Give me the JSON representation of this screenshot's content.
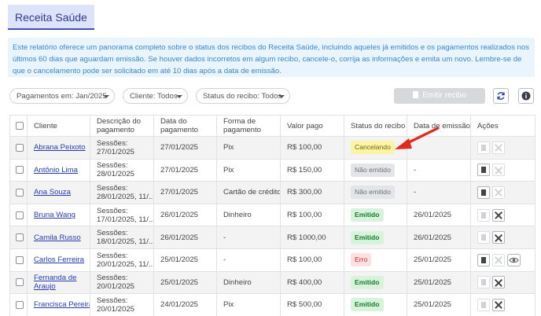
{
  "page_title": "Receita Saúde",
  "info_text": "Este relatório oferece um panorama completo sobre o status dos recibos do Receita Saúde, incluindo aqueles já emitidos e os pagamentos realizados nos últimos 60 dias que aguardam emissão. Se houver dados incorretos em algum recibo, cancele-o, corrija as informações e emita um novo. Lembre-se de que o cancelamento pode ser solicitado em até 10 dias após a data de emissão.",
  "filters": {
    "payments": "Pagamentos em: Jan/2025",
    "client": "Cliente: Todos",
    "receipt_status": "Status do recibo: Todos"
  },
  "emit_button": "Emitir recibo",
  "colors": {
    "accent": "#3f51b5",
    "info_bg": "#eaf4fd",
    "info_text": "#3a87c7",
    "link": "#2a3cab"
  },
  "columns": {
    "client": "Cliente",
    "description": "Descrição do pagamento",
    "payment_date": "Data do pagamento",
    "payment_method": "Forma de pagamento",
    "amount": "Valor pago",
    "status": "Status do recibo",
    "issue_date": "Data de emissão",
    "actions": "Ações"
  },
  "rows": [
    {
      "client": "Abrana Peixoto",
      "desc1": "Sessões:",
      "desc2": "27/01/2025",
      "date": "27/01/2025",
      "method": "Pix",
      "amount": "R$ 100,00",
      "status": "Cancelando",
      "status_kind": "cancel",
      "issued": ""
    },
    {
      "client": "Antônio Lima",
      "desc1": "Sessões:",
      "desc2": "28/01/2025",
      "date": "27/01/2025",
      "method": "Pix",
      "amount": "R$ 150,00",
      "status": "Não emitido",
      "status_kind": "none",
      "issued": "-"
    },
    {
      "client": "Ana Souza",
      "desc1": "Sessões:",
      "desc2": "28/01/2025, 11/...",
      "date": "27/01/2025",
      "method": "Cartão de crédito",
      "amount": "R$ 300,00",
      "status": "Não emitido",
      "status_kind": "none",
      "issued": "-"
    },
    {
      "client": "Bruna Wang",
      "desc1": "Sessões:",
      "desc2": "17/01/2025, 11/...",
      "date": "26/01/2025",
      "method": "Dinheiro",
      "amount": "R$ 100,00",
      "status": "Emitido",
      "status_kind": "ok",
      "issued": "26/01/2025"
    },
    {
      "client": "Camila Russo",
      "desc1": "Sessões:",
      "desc2": "18/01/2025, 11/...",
      "date": "26/01/2025",
      "method": "-",
      "amount": "R$ 1000,00",
      "status": "Emitido",
      "status_kind": "ok",
      "issued": "26/01/2025"
    },
    {
      "client": "Carlos Ferreira",
      "desc1": "Sessões:",
      "desc2": "20/01/2025, 11/...",
      "date": "25/01/2025",
      "method": "-",
      "amount": "R$ 100,00",
      "status": "Erro",
      "status_kind": "err",
      "issued": "25/01/2025"
    },
    {
      "client": "Fernanda de",
      "client2": "Araujo",
      "desc1": "Sessões:",
      "desc2": "20/01/2025",
      "date": "25/01/2025",
      "method": "Dinheiro",
      "amount": "R$ 400,00",
      "status": "Emitido",
      "status_kind": "ok",
      "issued": "25/01/2025"
    },
    {
      "client": "Francisca Pereira",
      "desc1": "Sessões:",
      "desc2": "20/01/2025",
      "date": "24/01/2025",
      "method": "Pix",
      "amount": "R$ 500,00",
      "status": "Emitido",
      "status_kind": "ok",
      "issued": "25/01/2025"
    }
  ]
}
